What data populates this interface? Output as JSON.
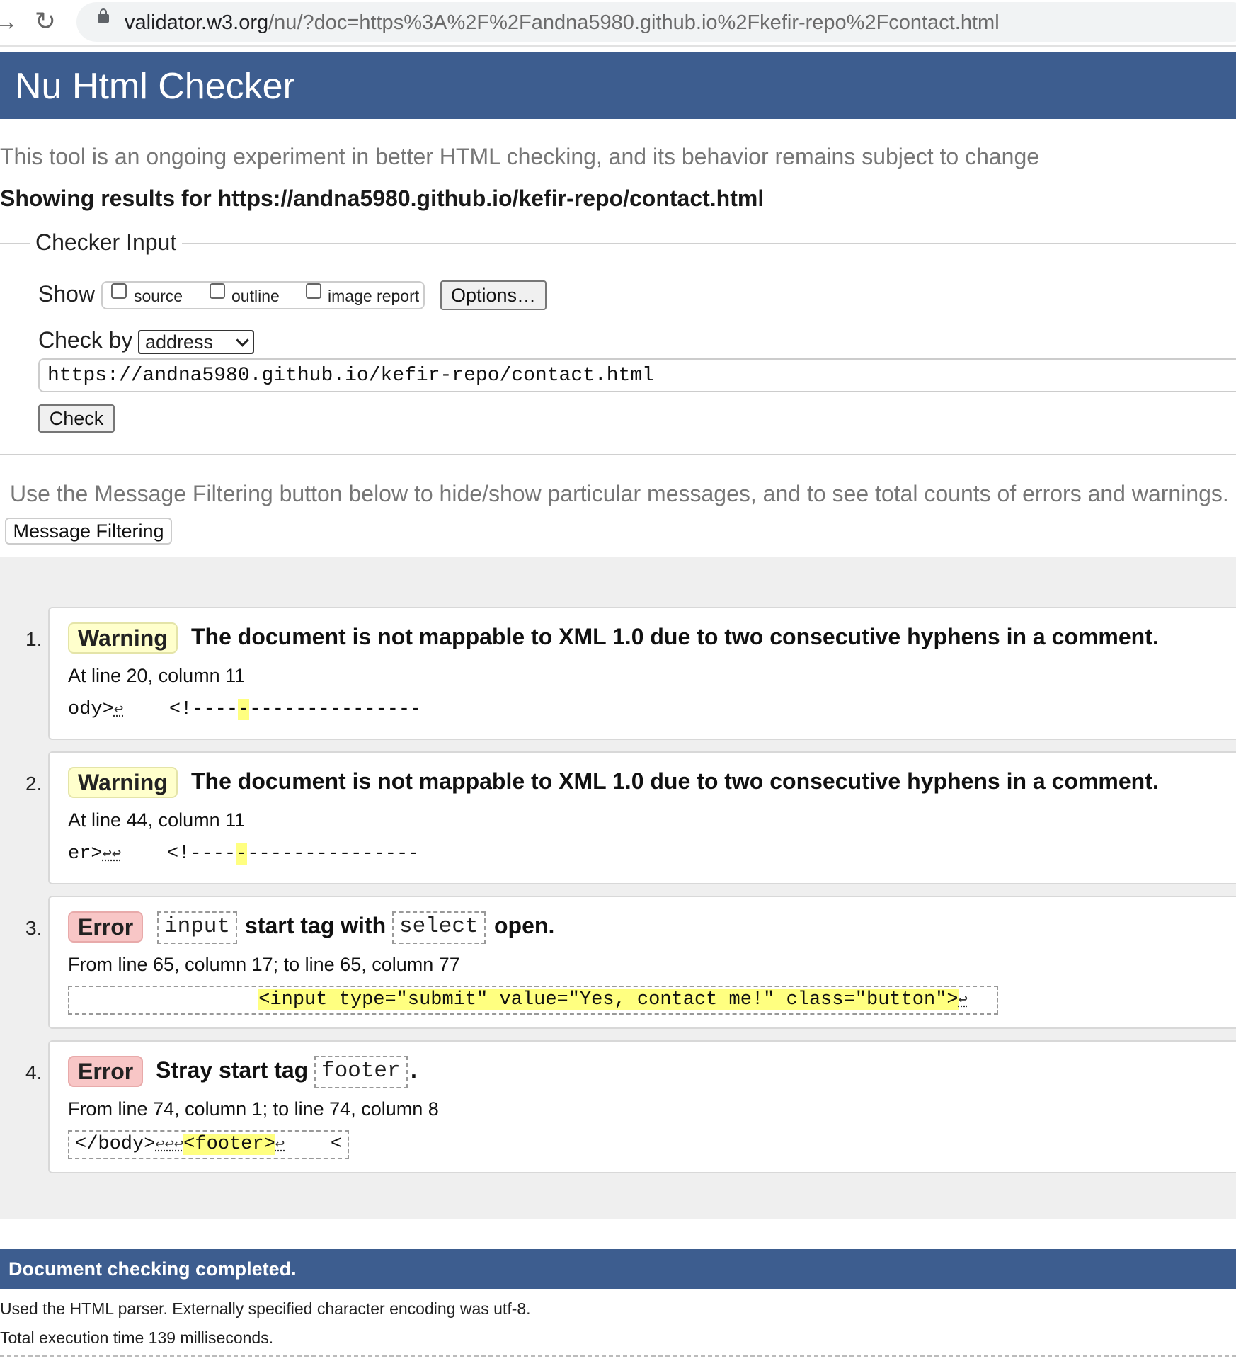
{
  "browser": {
    "url_host": "validator.w3.org",
    "url_path": "/nu/?doc=https%3A%2F%2Fandna5980.github.io%2Fkefir-repo%2Fcontact.html",
    "forward_icon": "arrow-right-icon",
    "reload_icon": "reload-icon",
    "lock_icon": "lock-icon"
  },
  "header": {
    "title": "Nu Html Checker"
  },
  "intro": {
    "tagline": "This tool is an ongoing experiment in better HTML checking, and its behavior remains subject to change",
    "results_for": "Showing results for https://andna5980.github.io/kefir-repo/contact.html"
  },
  "checker_input": {
    "legend": "Checker Input",
    "show_label": "Show",
    "show_options": [
      {
        "label": "source",
        "checked": false
      },
      {
        "label": "outline",
        "checked": false
      },
      {
        "label": "image report",
        "checked": false
      }
    ],
    "options_button": "Options…",
    "check_by_label": "Check by",
    "check_by_value": "address",
    "address_value": "https://andna5980.github.io/kefir-repo/contact.html",
    "check_button": "Check"
  },
  "filtering": {
    "note": "Use the Message Filtering button below to hide/show particular messages, and to see total counts of errors and warnings.",
    "button": "Message Filtering"
  },
  "messages": [
    {
      "number": "1.",
      "type": "Warning",
      "title": "The document is not mappable to XML 1.0 due to two consecutive hyphens in a comment.",
      "location": "At line 20, column 11",
      "extract_pre": "ody>",
      "extract_lf": "↩",
      "extract_mid": "    <!----",
      "extract_hl": "-",
      "extract_post": "---------------"
    },
    {
      "number": "2.",
      "type": "Warning",
      "title": "The document is not mappable to XML 1.0 due to two consecutive hyphens in a comment.",
      "location": "At line 44, column 11",
      "extract_pre": "er>",
      "extract_lf": "↩↩",
      "extract_mid": "    <!----",
      "extract_hl": "-",
      "extract_post": "---------------"
    },
    {
      "number": "3.",
      "type": "Error",
      "code1": "input",
      "text1": "start tag with",
      "code2": "select",
      "text2": "open.",
      "location": "From line 65, column 17; to line 65, column 77",
      "extract_pre": "                ",
      "extract_hl": "<input type=\"submit\" value=\"Yes, contact me!\" class=\"button\">",
      "extract_lf": "↩"
    },
    {
      "number": "4.",
      "type": "Error",
      "text1": "Stray start tag",
      "code1": "footer",
      "text2": ".",
      "location": "From line 74, column 1; to line 74, column 8",
      "extract_pre": "</body>",
      "extract_lf1": "↩↩↩",
      "extract_hl": "<footer>",
      "extract_lf2": "↩",
      "extract_post": "    <"
    }
  ],
  "footer": {
    "done": "Document checking completed.",
    "details1": "Used the HTML parser. Externally specified character encoding was utf-8.",
    "details2": "Total execution time 139 milliseconds."
  }
}
